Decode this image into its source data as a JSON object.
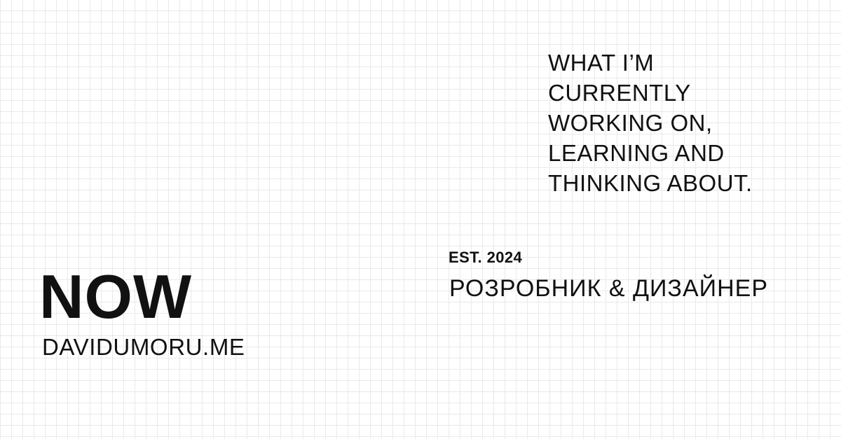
{
  "tagline": {
    "lines": [
      "WHAT I’M",
      "CURRENTLY",
      "WORKING ON,",
      "LEARNING AND",
      "THINKING ABOUT."
    ]
  },
  "established": "EST. 2024",
  "role": "РОЗРОБНИК & ДИЗАЙНЕР",
  "title": "NOW",
  "website": "DAVIDUMORU.ME",
  "colors": {
    "background": "#ffffff",
    "grid": "#e9e9e9",
    "text": "#111111"
  }
}
